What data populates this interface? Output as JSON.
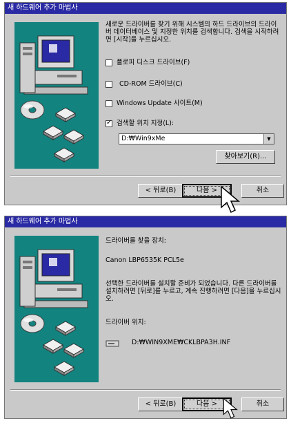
{
  "dialog1": {
    "title": "새 하드웨어 추가 마법사",
    "description": "새로운 드라이버를 찾기 위해 시스템의 하드 드라이브의 드라이버 데이터베이스 및 지정한 위치를 검색합니다. 검색을 시작하려면 [시작]을 누르십시오.",
    "options": [
      {
        "label": "플로피 디스크 드라이브(F)",
        "checked": false
      },
      {
        "label": "CD-ROM 드라이브(C)",
        "checked": false
      },
      {
        "label": "Windows Update 사이트(M)",
        "checked": false
      },
      {
        "label": "검색할 위치 지정(L):",
        "checked": true
      }
    ],
    "location_value": "D:₩Win9xMe",
    "browse_label": "찾아보기(R)...",
    "back_label": "< 뒤로(B)",
    "next_label": "다음 >",
    "cancel_label": "취소"
  },
  "dialog2": {
    "title": "새 하드웨어 추가 마법사",
    "device_heading": "드라이버를 찾을 장치:",
    "device_name": "Canon LBP6535K PCL5e",
    "ready_text": "선택한 드라이버를 설치할 준비가 되었습니다. 다른 드라이버를 설치하려면 [뒤로]를 누르고, 계속 진행하려면 [다음]을 누르십시오.",
    "location_heading": "드라이버 위치:",
    "driver_path": "D:₩WIN9XME₩CKLBPA3H.INF",
    "back_label": "< 뒤로(B)",
    "next_label": "다음 >",
    "cancel_label": "취소"
  },
  "icons": [
    "computer-icon",
    "cd-disc-icon",
    "floppy-disk-icon",
    "arrow-cursor-icon",
    "drive-icon"
  ],
  "colors": {
    "title_bar": "#2a2aa4",
    "illustration_bg": "#12837f",
    "dialog_bg": "#c9c9c9"
  }
}
